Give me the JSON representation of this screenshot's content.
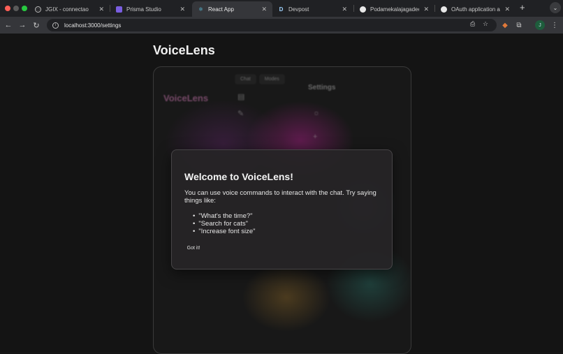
{
  "browser": {
    "tabs": [
      {
        "label": "JGIX - connectao",
        "favicon": "globe-icon",
        "active": false
      },
      {
        "label": "Prisma Studio",
        "favicon": "prisma-icon",
        "active": false
      },
      {
        "label": "React App",
        "favicon": "react-icon",
        "active": true
      },
      {
        "label": "Devpost",
        "favicon": "devpost-icon",
        "active": false
      },
      {
        "label": "Podamekalajagadeesh/",
        "favicon": "github-icon",
        "active": false
      },
      {
        "label": "OAuth application autho",
        "favicon": "github-icon",
        "active": false
      }
    ],
    "url": "localhost:3000/settings",
    "profile_initial": "J"
  },
  "app": {
    "title": "VoiceLens",
    "background": {
      "logo": "VoiceLens",
      "tabs": [
        "Chat",
        "Modes"
      ],
      "settings_heading": "Settings"
    }
  },
  "modal": {
    "title": "Welcome to VoiceLens!",
    "body": "You can use voice commands to interact with the chat. Try saying things like:",
    "examples": [
      "\"What's the time?\"",
      "\"Search for cats\"",
      "\"Increase font size\""
    ],
    "button_label": "Got it!"
  },
  "colors": {
    "accent_pink": "#d27ab6",
    "page_bg": "#141414",
    "modal_bg": "#262426"
  }
}
